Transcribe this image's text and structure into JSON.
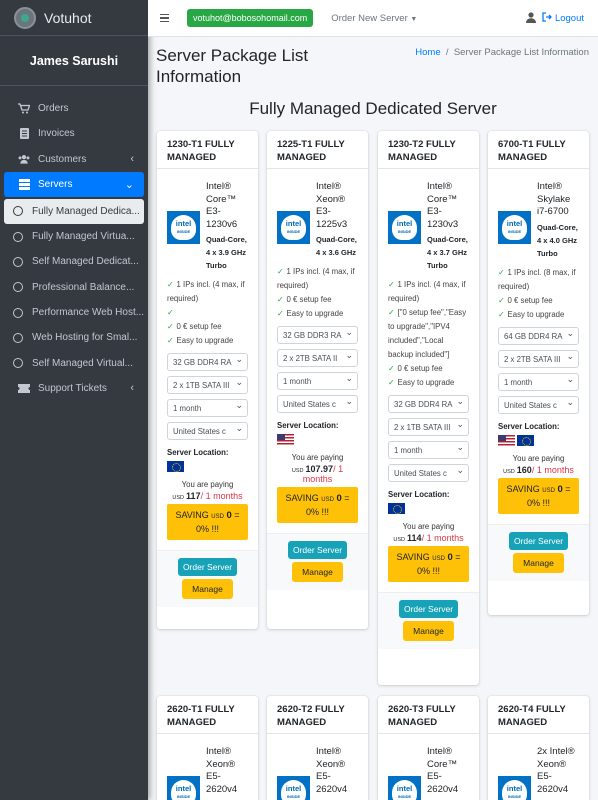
{
  "brand": {
    "name": "Votuhot"
  },
  "user": {
    "name": "James Sarushi"
  },
  "nav": {
    "orders": "Orders",
    "invoices": "Invoices",
    "customers": "Customers",
    "servers": "Servers",
    "sub": [
      "Fully Managed Dedica...",
      "Fully Managed Virtua...",
      "Self Managed Dedicat...",
      "Professional Balance...",
      "Performance Web Host...",
      "Web Hosting for Smal...",
      "Self Managed Virtual..."
    ],
    "support": "Support Tickets"
  },
  "topbar": {
    "email": "votuhot@bobosohomail.com",
    "order_new": "Order New Server",
    "logout": "Logout"
  },
  "page": {
    "title": "Server Package List Information",
    "breadcrumb_home": "Home",
    "breadcrumb_current": "Server Package List Information",
    "section_title": "Fully Managed Dedicated Server"
  },
  "cards": [
    {
      "title": "1230-T1 FULLY MANAGED",
      "cpu": "Intel® Core™ E3-1230v6",
      "spec": "Quad-Core, 4 x 3.9 GHz Turbo",
      "features": [
        "1 IPs incl. (4 max, if required)",
        "",
        "0 € setup fee",
        "Easy to upgrade"
      ],
      "selects": [
        "32 GB DDR4 RA",
        "2 x 1TB SATA III",
        "1 month",
        "United States c"
      ],
      "location_label": "Server Location:",
      "paying_label": "You are paying",
      "currency": "USD",
      "amount": "117",
      "months": "/ 1 months",
      "saving_label": "SAVING",
      "saving_value": "0",
      "saving_pct": "0% !!!",
      "order_label": "Order Server",
      "manage_label": "Manage"
    },
    {
      "title": "1225-T1 FULLY MANAGED",
      "cpu": "Intel® Xeon® E3-1225v3",
      "spec": "Quad-Core, 4 x 3.6 GHz",
      "features": [
        "1 IPs incl. (4 max, if required)",
        "0 € setup fee",
        "Easy to upgrade"
      ],
      "selects": [
        "32 GB DDR3 RA",
        "2 x 2TB SATA II",
        "1 month",
        "United States c"
      ],
      "location_label": "Server Location:",
      "paying_label": "You are paying",
      "currency": "USD",
      "amount": "107.97",
      "months": "/ 1 months",
      "saving_label": "SAVING",
      "saving_value": "0",
      "saving_pct": "0% !!!",
      "order_label": "Order Server",
      "manage_label": "Manage"
    },
    {
      "title": "1230-T2 FULLY MANAGED",
      "cpu": "Intel® Core™ E3-1230v3",
      "spec": "Quad-Core, 4 x 3.7 GHz Turbo",
      "features": [
        "1 IPs incl. (4 max, if required)",
        "[\"0 setup fee\",\"Easy to upgrade\",\"IPV4 included\",\"Local backup included\"]",
        "0 € setup fee",
        "Easy to upgrade"
      ],
      "selects": [
        "32 GB DDR4 RA",
        "2 x 1TB SATA III",
        "1 month",
        "United States c"
      ],
      "location_label": "Server Location:",
      "paying_label": "You are paying",
      "currency": "USD",
      "amount": "114",
      "months": "/ 1 months",
      "saving_label": "SAVING",
      "saving_value": "0",
      "saving_pct": "0% !!!",
      "order_label": "Order Server",
      "manage_label": "Manage"
    },
    {
      "title": "6700-T1 FULLY MANAGED",
      "cpu": "Intel® Skylake i7-6700",
      "spec": "Quad-Core, 4 x 4.0 GHz Turbo",
      "features": [
        "1 IPs incl. (8 max, if required)",
        "0 € setup fee",
        "Easy to upgrade"
      ],
      "selects": [
        "64 GB DDR4 RA",
        "2 x 2TB SATA III",
        "1 month",
        "United States c"
      ],
      "location_label": "Server Location:",
      "paying_label": "You are paying",
      "currency": "USD",
      "amount": "160",
      "months": "/ 1 months",
      "saving_label": "SAVING",
      "saving_value": "0",
      "saving_pct": "0% !!!",
      "order_label": "Order Server",
      "manage_label": "Manage"
    }
  ],
  "cards2": [
    {
      "title": "2620-T1 FULLY MANAGED",
      "cpu": "Intel® Xeon® E5-2620v4"
    },
    {
      "title": "2620-T2 FULLY MANAGED",
      "cpu": "Intel® Xeon® E5-2620v4"
    },
    {
      "title": "2620-T3 FULLY MANAGED",
      "cpu": "Intel® Core™ E5-2620v4"
    },
    {
      "title": "2620-T4 FULLY MANAGED",
      "cpu": "2x Intel® Xeon® E5-2620v4"
    }
  ],
  "intel_logo": {
    "word": "intel",
    "tag": "INSIDE"
  }
}
